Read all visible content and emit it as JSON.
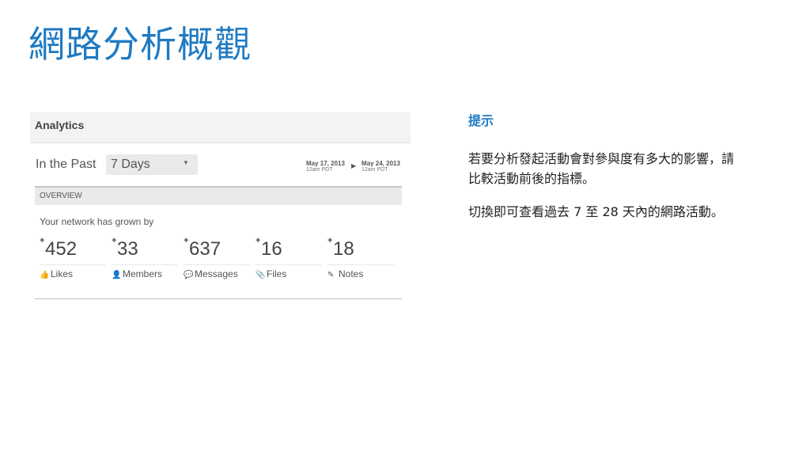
{
  "slide": {
    "title": "網路分析概觀"
  },
  "analytics": {
    "header": "Analytics",
    "range_label": "In the Past",
    "range_select": "7 Days",
    "date_from": {
      "date": "May 17, 2013",
      "time": "12am PDT"
    },
    "date_to": {
      "date": "May 24, 2013",
      "time": "12am PDT"
    },
    "overview_label": "OVERVIEW",
    "growth_text": "Your network has grown by",
    "stats": [
      {
        "plus": "+",
        "value": "452",
        "icon": "thumbs-up-icon",
        "label": "Likes"
      },
      {
        "plus": "+",
        "value": "33",
        "icon": "person-icon",
        "label": "Members"
      },
      {
        "plus": "+",
        "value": "637",
        "icon": "speech-bubble-icon",
        "label": "Messages"
      },
      {
        "plus": "+",
        "value": "16",
        "icon": "paperclip-icon",
        "label": "Files"
      },
      {
        "plus": "+",
        "value": "18",
        "icon": "notepad-icon",
        "label": "Notes"
      }
    ]
  },
  "tip": {
    "title": "提示",
    "paragraph1": "若要分析發起活動會對參與度有多大的影響，請比較活動前後的指標。",
    "paragraph2": "切換即可查看過去 7 至 28 天內的網路活動。"
  },
  "colors": {
    "accent": "#1f7ac2"
  }
}
